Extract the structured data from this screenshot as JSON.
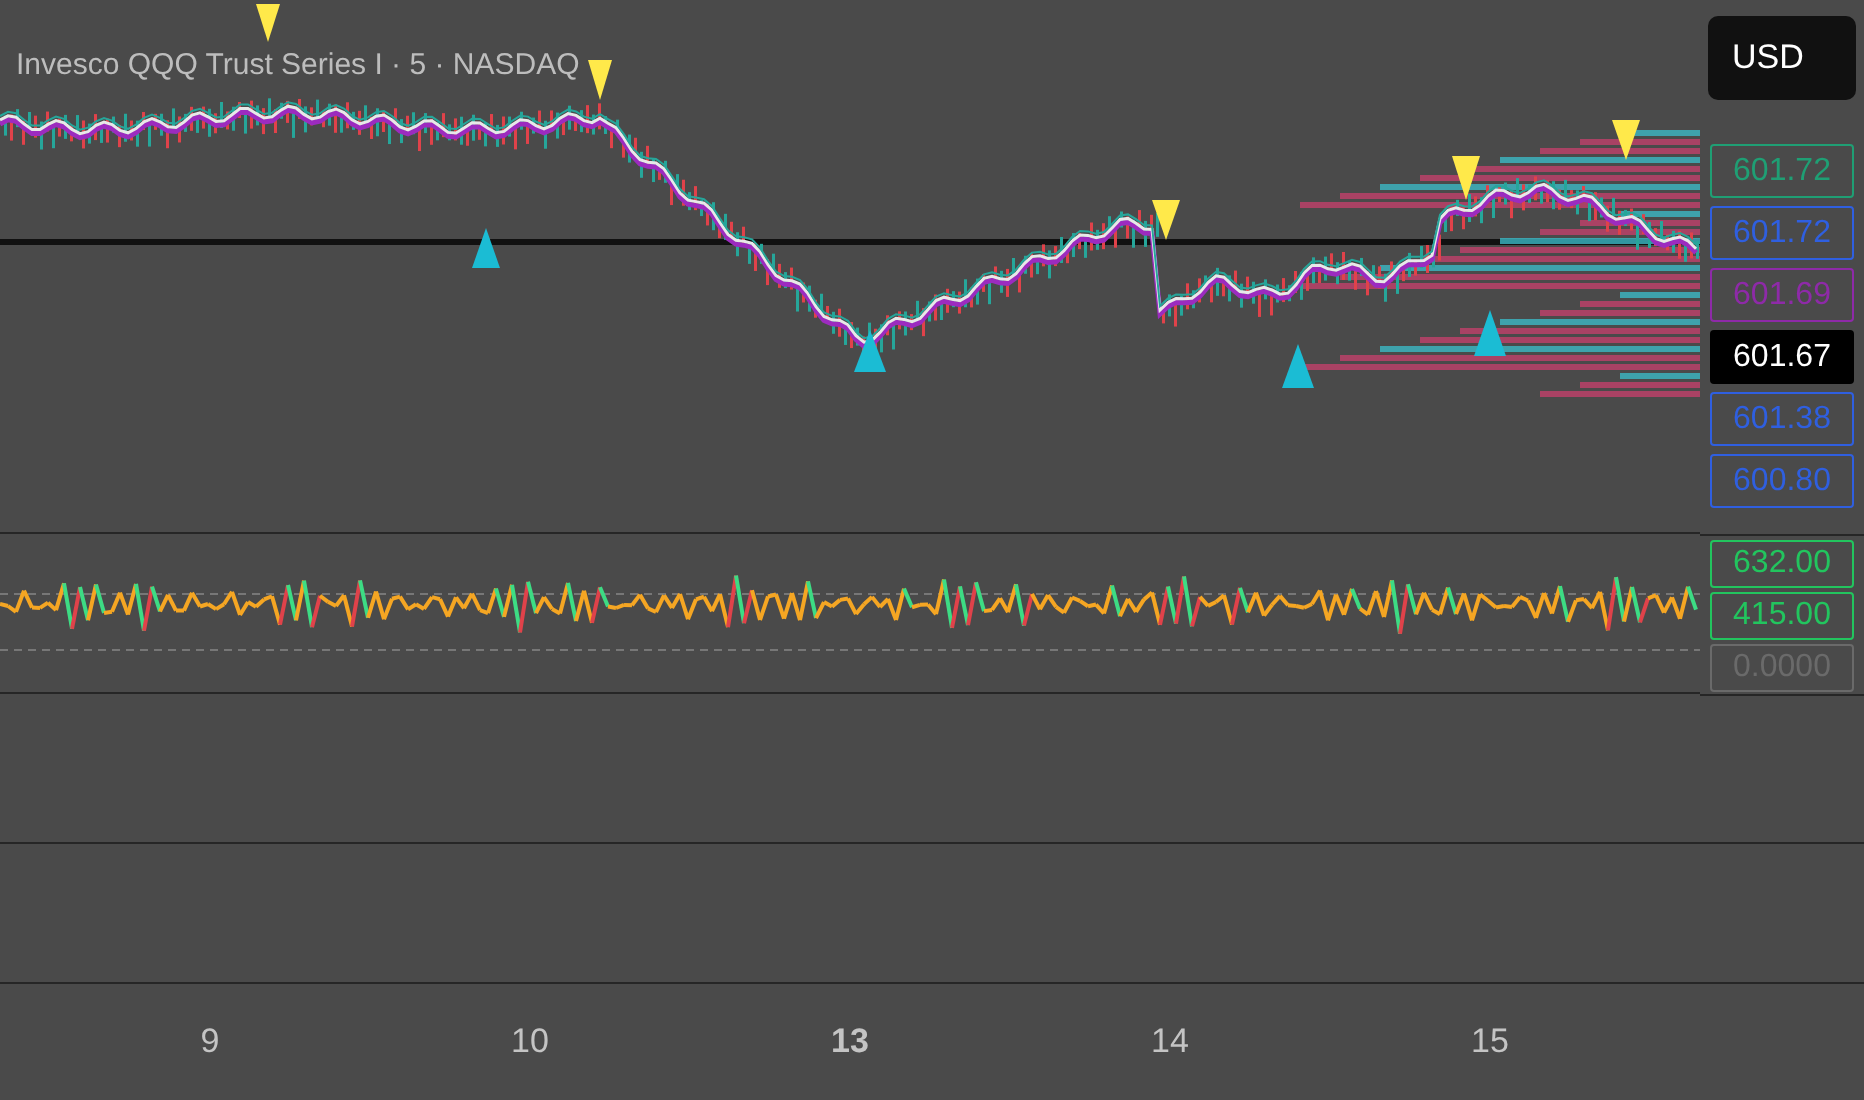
{
  "chart": {
    "title": "Invesco QQQ Trust Series I · 5 · NASDAQ",
    "currency": "USD"
  },
  "price_labels": [
    {
      "value": "601.72",
      "color": "#1f9f74",
      "kind": "outlined"
    },
    {
      "value": "601.72",
      "color": "#2f5fe0",
      "kind": "outlined"
    },
    {
      "value": "601.69",
      "color": "#8e2aa8",
      "kind": "outlined"
    },
    {
      "value": "601.67",
      "color": "#000000",
      "kind": "filled"
    },
    {
      "value": "601.38",
      "color": "#2f5fe0",
      "kind": "outlined"
    },
    {
      "value": "600.80",
      "color": "#2f5fe0",
      "kind": "outlined"
    }
  ],
  "oscillator_labels": [
    {
      "value": "632.00",
      "color": "#22c55e"
    },
    {
      "value": "415.00",
      "color": "#22c55e"
    },
    {
      "value": "0.0000",
      "color": "#6a6a6a"
    }
  ],
  "time_axis": [
    {
      "label": "9",
      "bold": false
    },
    {
      "label": "10",
      "bold": false
    },
    {
      "label": "13",
      "bold": true
    },
    {
      "label": "14",
      "bold": false
    },
    {
      "label": "15",
      "bold": false
    }
  ]
}
